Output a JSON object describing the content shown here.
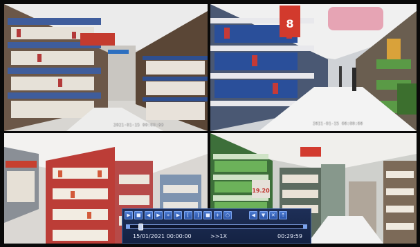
{
  "cameras": [
    {
      "id": "cam-1",
      "timestamp": "2021-01-15 00:00:00"
    },
    {
      "id": "cam-2",
      "timestamp": "2021-01-15 00:00:00"
    },
    {
      "id": "cam-3",
      "timestamp": ""
    },
    {
      "id": "cam-4",
      "timestamp": ""
    }
  ],
  "playback": {
    "buttons": [
      {
        "icon": "play-icon",
        "glyph": "▶"
      },
      {
        "icon": "stop-icon",
        "glyph": "■"
      },
      {
        "icon": "slow-rewind-icon",
        "glyph": "◀"
      },
      {
        "icon": "slow-forward-icon",
        "glyph": "▶"
      },
      {
        "icon": "fast-forward-icon",
        "glyph": "»"
      },
      {
        "icon": "step-forward-icon",
        "glyph": "▶"
      },
      {
        "icon": "clip-start-icon",
        "glyph": "["
      },
      {
        "icon": "clip-end-icon",
        "glyph": "]"
      },
      {
        "icon": "save-icon",
        "glyph": "■"
      },
      {
        "icon": "zoom-icon",
        "glyph": "+"
      },
      {
        "icon": "refresh-icon",
        "glyph": "○"
      },
      {
        "icon": "volume-icon",
        "glyph": "◀"
      },
      {
        "icon": "backup-icon",
        "glyph": "▼"
      },
      {
        "icon": "close-icon",
        "glyph": "✕"
      },
      {
        "icon": "exit-icon",
        "glyph": "⇡"
      }
    ],
    "progress_fraction": 0.05,
    "start_datetime": "15/01/2021 00:00:00",
    "speed": ">>1X",
    "elapsed": "00:29:59"
  }
}
